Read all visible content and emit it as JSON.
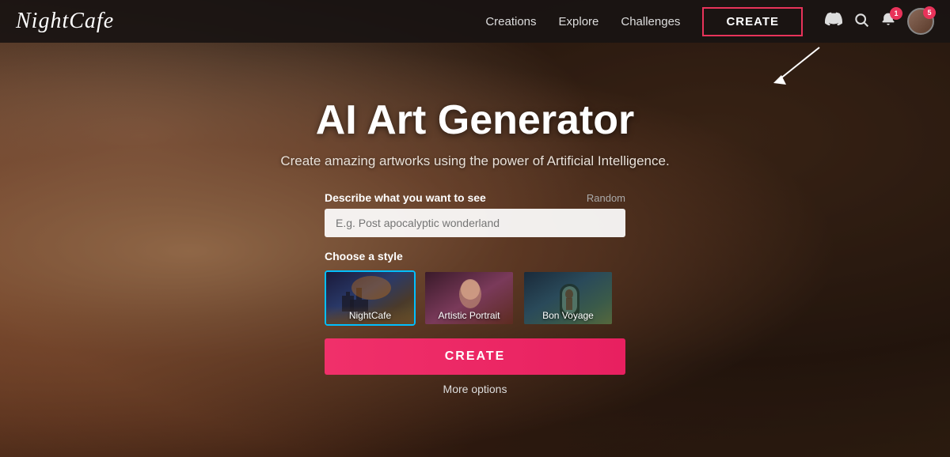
{
  "brand": {
    "logo": "NightCafe"
  },
  "navbar": {
    "links": [
      {
        "id": "creations",
        "label": "Creations"
      },
      {
        "id": "explore",
        "label": "Explore"
      },
      {
        "id": "challenges",
        "label": "Challenges"
      }
    ],
    "create_btn": "CREATE",
    "notification_badge": "1",
    "messages_badge": "5"
  },
  "hero": {
    "title": "AI Art Generator",
    "subtitle": "Create amazing artworks using the power of Artificial Intelligence."
  },
  "form": {
    "prompt_label": "Describe what you want to see",
    "random_label": "Random",
    "prompt_placeholder": "E.g. Post apocalyptic wonderland",
    "style_label": "Choose a style",
    "styles": [
      {
        "id": "nightcafe",
        "label": "NightCafe",
        "selected": true
      },
      {
        "id": "artistic-portrait",
        "label": "Artistic Portrait",
        "selected": false
      },
      {
        "id": "bon-voyage",
        "label": "Bon Voyage",
        "selected": false
      }
    ],
    "create_btn": "CREATE",
    "more_options": "More options"
  }
}
